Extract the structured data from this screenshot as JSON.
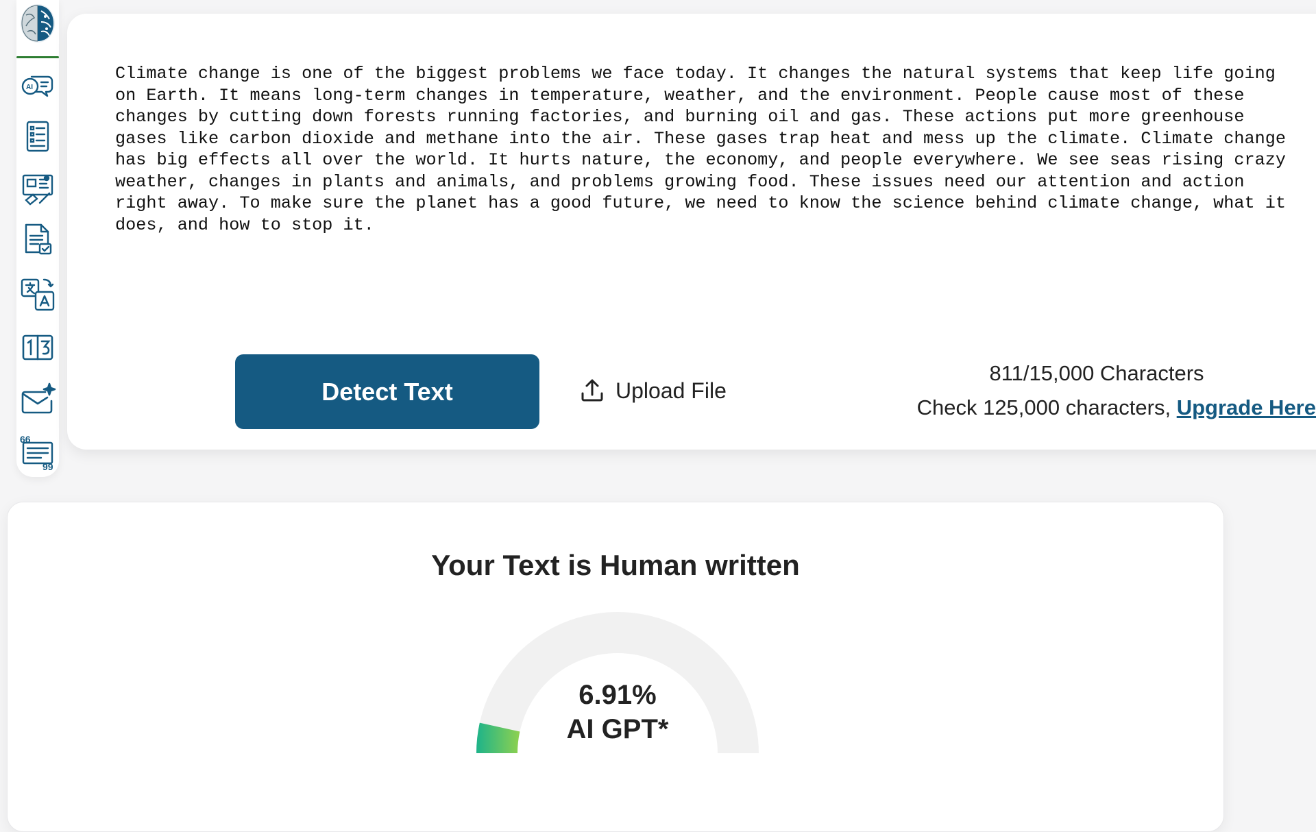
{
  "sidebar": {
    "logo_name": "brain-logo",
    "items": [
      {
        "name": "ai-chat-icon"
      },
      {
        "name": "document-list-icon"
      },
      {
        "name": "blueprint-tools-icon"
      },
      {
        "name": "document-check-icon"
      },
      {
        "name": "translate-icon"
      },
      {
        "name": "number-grid-icon"
      },
      {
        "name": "email-sparkle-icon"
      },
      {
        "name": "quote-document-icon"
      }
    ],
    "accent_color": "#2e7d32",
    "icon_color": "#155a82"
  },
  "editor": {
    "text": "Climate change is one of the biggest problems we face today. It changes the natural systems that keep life going on Earth. It means long-term changes in temperature, weather, and the environment. People cause most of these changes by cutting down forests running factories, and burning oil and gas. These actions put more greenhouse gases like carbon dioxide and methane into the air. These gases trap heat and mess up the climate. Climate change has big effects all over the world. It hurts nature, the economy, and people everywhere. We see seas rising crazy weather, changes in plants and animals, and problems growing food. These issues need our attention and action right away. To make sure the planet has a good future, we need to know the science behind climate change, what it does, and how to stop it."
  },
  "actions": {
    "detect_label": "Detect Text",
    "upload_label": "Upload File",
    "char_count": "811/15,000 Characters",
    "check_limit_text": "Check 125,000 characters, ",
    "upgrade_label": "Upgrade Here",
    "primary_color": "#155a82"
  },
  "result": {
    "title": "Your Text is Human written",
    "ai_percent": 6.91,
    "percent_label": "6.91%",
    "gauge_label": "AI GPT*",
    "gauge_track_color": "#f1f1f1",
    "gauge_fill_start": "#1db38a",
    "gauge_fill_end": "#8fd14f"
  }
}
